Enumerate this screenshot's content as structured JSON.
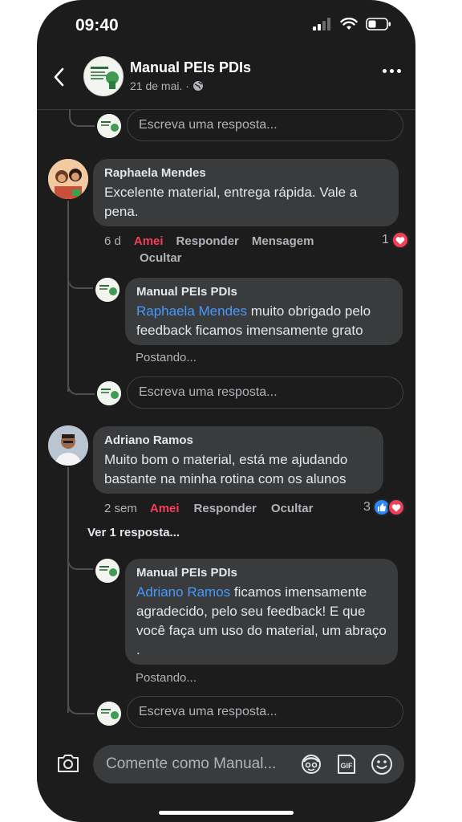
{
  "status": {
    "time": "09:40"
  },
  "header": {
    "page_name": "Manual PEIs PDIs",
    "date": "21 de mai. ·"
  },
  "reply_placeholder": "Escreva uma resposta...",
  "comments": [
    {
      "author": "Raphaela Mendes",
      "text": "Excelente material,  entrega rápida.  Vale a pena.",
      "time": "6 d",
      "reaction_label": "Amei",
      "reply_label": "Responder",
      "message_label": "Mensagem",
      "hide_label": "Ocultar",
      "reaction_count": "1",
      "reply": {
        "author": "Manual PEIs PDIs",
        "mention": "Raphaela Mendes",
        "text": " muito obrigado pelo feedback ficamos imensamente grato",
        "status": "Postando..."
      }
    },
    {
      "author": "Adriano Ramos",
      "text": "Muito bom o material, está me ajudando bastante na minha rotina com os alunos",
      "time": "2 sem",
      "reaction_label": "Amei",
      "reply_label": "Responder",
      "hide_label": "Ocultar",
      "reaction_count": "3",
      "view_replies": "Ver 1 resposta...",
      "reply": {
        "author": "Manual PEIs PDIs",
        "mention": "Adriano Ramos",
        "text": " ficamos imensamente agradecido, pelo seu feedback! E que você faça um uso do material, um abraço .",
        "status": "Postando..."
      }
    }
  ],
  "composer": {
    "placeholder": "Comente como Manual..."
  },
  "icons": [
    "back-arrow-icon",
    "more-icon",
    "globe-icon",
    "camera-icon",
    "avatar-sticker-icon",
    "gif-icon",
    "emoji-icon",
    "heart-icon",
    "like-icon",
    "signal-icon",
    "wifi-icon",
    "battery-icon"
  ],
  "colors": {
    "background": "#1c1c1d",
    "bubble": "#3a3b3c",
    "mention": "#4599ff",
    "love": "#f33e58",
    "like": "#2d88ff"
  }
}
